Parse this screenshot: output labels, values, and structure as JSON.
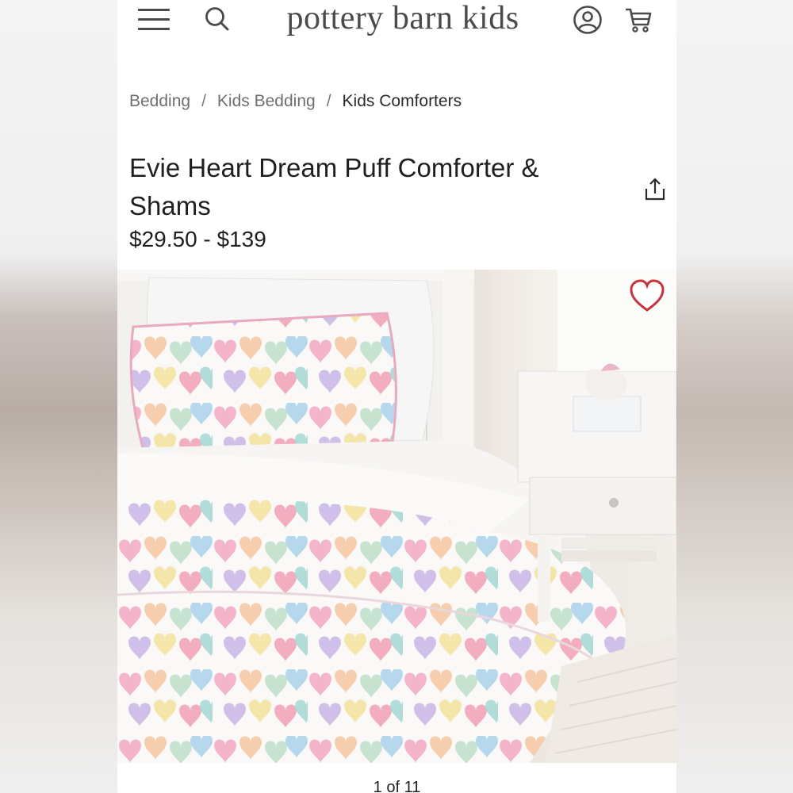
{
  "header": {
    "brand": "pottery barn kids",
    "icons": [
      "menu-icon",
      "search-icon",
      "account-icon",
      "cart-icon"
    ]
  },
  "breadcrumb": {
    "items": [
      "Bedding",
      "Kids Bedding",
      "Kids Comforters"
    ],
    "separator": "/"
  },
  "product": {
    "title": "Evie Heart Dream Puff Comforter & Shams",
    "price": "$29.50 - $139",
    "favorite_icon": "heart-outline-icon",
    "share_icon": "share-icon"
  },
  "gallery": {
    "counter": "1 of 11"
  },
  "colors": {
    "text": "#1f1f1f",
    "muted": "#6f6f6f",
    "favorite": "#c4323a"
  }
}
